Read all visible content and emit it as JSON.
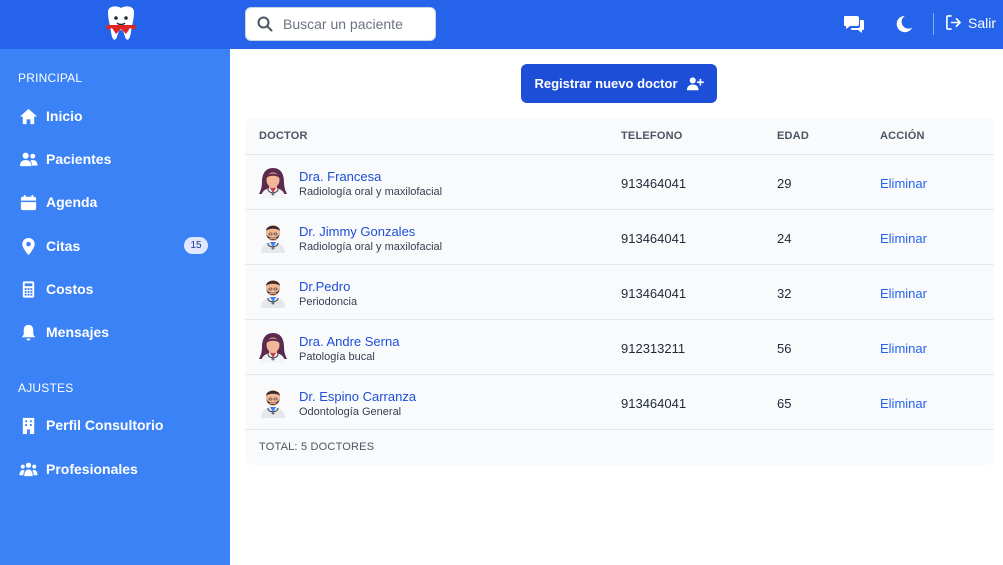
{
  "header": {
    "search_placeholder": "Buscar un paciente",
    "logout_label": "Salir",
    "icons": [
      "tooth-logo",
      "search-icon",
      "chat-icon",
      "moon-icon",
      "logout-icon"
    ]
  },
  "sidebar": {
    "principal_heading": "PRINCIPAL",
    "settings_heading": "AJUSTES",
    "items": [
      {
        "label": "Inicio",
        "icon": "home-icon"
      },
      {
        "label": "Pacientes",
        "icon": "users-icon"
      },
      {
        "label": "Agenda",
        "icon": "calendar-icon"
      },
      {
        "label": "Citas",
        "icon": "location-pin-icon",
        "badge": "15"
      },
      {
        "label": "Costos",
        "icon": "calculator-icon"
      },
      {
        "label": "Mensajes",
        "icon": "bell-icon"
      }
    ],
    "settings_items": [
      {
        "label": "Perfil Consultorio",
        "icon": "building-icon"
      },
      {
        "label": "Profesionales",
        "icon": "people-group-icon"
      }
    ]
  },
  "main": {
    "register_button": "Registrar nuevo doctor",
    "table": {
      "columns": [
        "DOCTOR",
        "TELEFONO",
        "EDAD",
        "ACCIÓN"
      ],
      "rows": [
        {
          "name": "Dra. Francesa",
          "specialty": "Radiología oral y maxilofacial",
          "phone": "913464041",
          "age": "29",
          "action": "Eliminar",
          "avatar": "female-doctor-avatar"
        },
        {
          "name": "Dr. Jimmy Gonzales",
          "specialty": "Radiología oral y maxilofacial",
          "phone": "913464041",
          "age": "24",
          "action": "Eliminar",
          "avatar": "male-doctor-avatar"
        },
        {
          "name": "Dr.Pedro",
          "specialty": "Periodoncia",
          "phone": "913464041",
          "age": "32",
          "action": "Eliminar",
          "avatar": "male-doctor-avatar"
        },
        {
          "name": "Dra. Andre Serna",
          "specialty": "Patología bucal",
          "phone": "912313211",
          "age": "56",
          "action": "Eliminar",
          "avatar": "female-doctor-avatar"
        },
        {
          "name": "Dr. Espino Carranza",
          "specialty": "Odontología General",
          "phone": "913464041",
          "age": "65",
          "action": "Eliminar",
          "avatar": "male-doctor-avatar"
        }
      ],
      "total": "TOTAL: 5 DOCTORES"
    }
  },
  "colors": {
    "topbar": "#2563eb",
    "sidebar": "#3b82f6",
    "primary_button": "#1d4ed8",
    "link": "#2563eb"
  }
}
